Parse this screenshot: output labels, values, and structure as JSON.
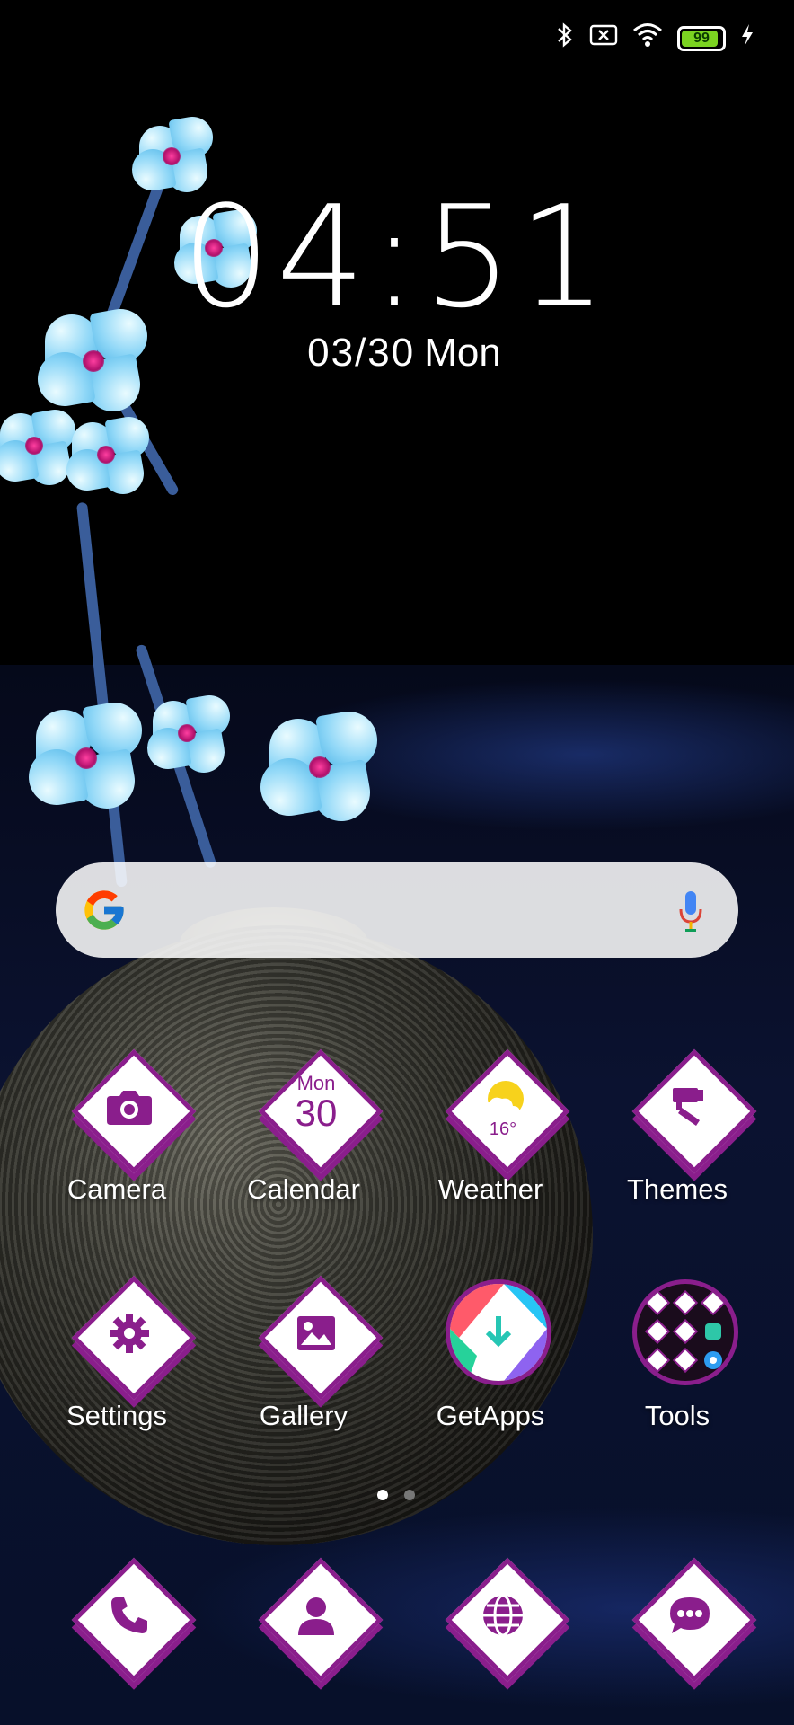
{
  "status_bar": {
    "icons": [
      "bluetooth-icon",
      "no-sim-icon",
      "wifi-icon",
      "battery-icon",
      "charging-icon"
    ],
    "battery_level": "99",
    "battery_fraction": 0.99
  },
  "clock": {
    "time": "04:51",
    "date_md": "03/30",
    "date_dow": "Mon"
  },
  "search_bar": {
    "logo_icon": "google-logo-icon",
    "mic_icon": "microphone-icon"
  },
  "apps_row1": [
    {
      "label": "Camera",
      "icon": "camera-icon"
    },
    {
      "label": "Calendar",
      "icon": "calendar-icon",
      "badge_day": "Mon",
      "badge_date": "30"
    },
    {
      "label": "Weather",
      "icon": "weather-icon",
      "temp": "16°"
    },
    {
      "label": "Themes",
      "icon": "brush-icon"
    }
  ],
  "apps_row2": [
    {
      "label": "Settings",
      "icon": "gear-icon"
    },
    {
      "label": "Gallery",
      "icon": "image-icon"
    },
    {
      "label": "GetApps",
      "icon": "getapps-icon"
    },
    {
      "label": "Tools",
      "icon": "tools-folder-icon"
    }
  ],
  "page_indicator": {
    "pages": 2,
    "current": 1
  },
  "dock": [
    {
      "icon": "phone-icon"
    },
    {
      "icon": "contacts-icon"
    },
    {
      "icon": "browser-icon"
    },
    {
      "icon": "messages-icon"
    }
  ],
  "colors": {
    "accent": "#8a1e8c",
    "battery": "#7bd321"
  }
}
